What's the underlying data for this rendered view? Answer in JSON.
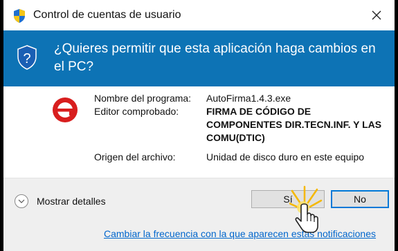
{
  "window": {
    "title": "Control de cuentas de usuario",
    "title_icon": "uac-shield-icon",
    "close_icon": "close-icon"
  },
  "banner": {
    "question": "¿Quieres permitir que esta aplicación haga cambios en el PC?",
    "icon": "question-shield-icon",
    "background": "#0d73b5"
  },
  "details": {
    "app_icon": "autofirma-logo",
    "labels": {
      "program": "Nombre del programa:",
      "publisher": "Editor comprobado:",
      "origin": "Origen del archivo:"
    },
    "values": {
      "program": "AutoFirma1.4.3.exe",
      "publisher": "FIRMA DE CÓDIGO DE COMPONENTES DIR.TECN.INF. Y LAS COMU(DTIC)",
      "origin": "Unidad de disco duro en este equipo"
    }
  },
  "footer": {
    "show_details": "Mostrar detalles",
    "yes_label": "Sí",
    "no_label": "No",
    "link": "Cambiar la frecuencia con la que aparecen estas notificaciones",
    "link_color": "#0066cc"
  }
}
